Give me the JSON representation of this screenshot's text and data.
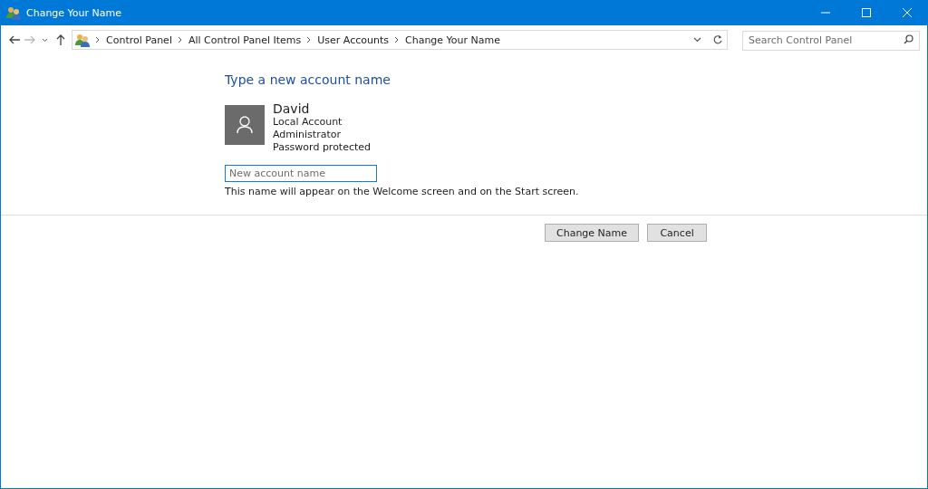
{
  "window": {
    "title": "Change Your Name"
  },
  "breadcrumbs": [
    "Control Panel",
    "All Control Panel Items",
    "User Accounts",
    "Change Your Name"
  ],
  "search": {
    "placeholder": "Search Control Panel"
  },
  "heading": "Type a new account name",
  "account": {
    "name": "David",
    "details": [
      "Local Account",
      "Administrator",
      "Password protected"
    ]
  },
  "name_field": {
    "placeholder": "New account name",
    "focused": true
  },
  "hint": "This name will appear on the Welcome screen and on the Start screen.",
  "buttons": [
    "Change Name",
    "Cancel"
  ]
}
